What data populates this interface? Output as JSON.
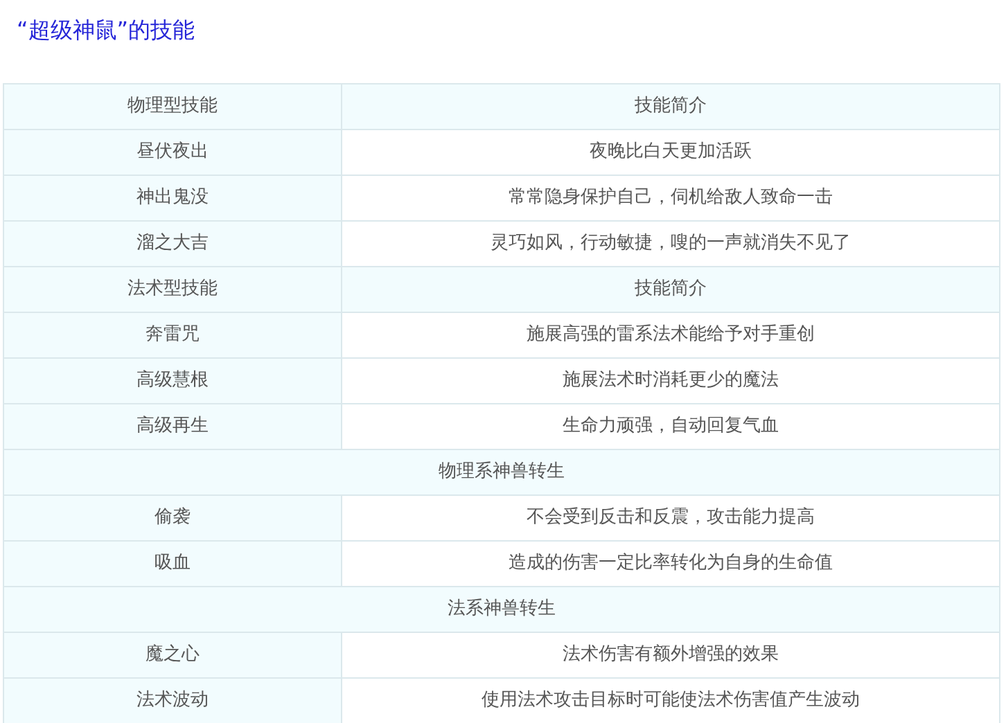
{
  "title": "“超级神鼠”的技能",
  "rows": [
    {
      "kind": "header",
      "cells": [
        "物理型技能",
        "技能简介"
      ]
    },
    {
      "kind": "skill",
      "cells": [
        "昼伏夜出",
        "夜晚比白天更加活跃"
      ]
    },
    {
      "kind": "skill",
      "cells": [
        "神出鬼没",
        "常常隐身保护自己，伺机给敌人致命一击"
      ]
    },
    {
      "kind": "skill",
      "cells": [
        "溜之大吉",
        "灵巧如风，行动敏捷，嗖的一声就消失不见了"
      ]
    },
    {
      "kind": "header",
      "cells": [
        "法术型技能",
        "技能简介"
      ]
    },
    {
      "kind": "skill",
      "cells": [
        "奔雷咒",
        "施展高强的雷系法术能给予对手重创"
      ]
    },
    {
      "kind": "skill",
      "cells": [
        "高级慧根",
        "施展法术时消耗更少的魔法"
      ]
    },
    {
      "kind": "skill",
      "cells": [
        "高级再生",
        "生命力顽强，自动回复气血"
      ]
    },
    {
      "kind": "section",
      "cells": [
        "物理系神兽转生"
      ]
    },
    {
      "kind": "skill",
      "cells": [
        "偷袭",
        "不会受到反击和反震，攻击能力提高"
      ]
    },
    {
      "kind": "skill",
      "cells": [
        "吸血",
        "造成的伤害一定比率转化为自身的生命值"
      ]
    },
    {
      "kind": "section",
      "cells": [
        "法系神兽转生"
      ]
    },
    {
      "kind": "skill",
      "cells": [
        "魔之心",
        "法术伤害有额外增强的效果"
      ]
    },
    {
      "kind": "skill",
      "cells": [
        "法术波动",
        "使用法术攻击目标时可能使法术伤害值产生波动"
      ]
    }
  ]
}
